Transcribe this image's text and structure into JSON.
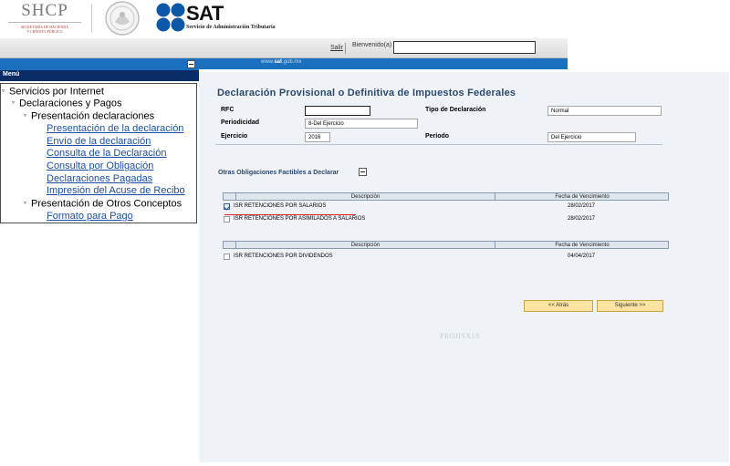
{
  "header": {
    "shcp_title": "SHCP",
    "shcp_subtitle_line1": "SECRETARÍA DE HACIENDA",
    "shcp_subtitle_line2": "Y CRÉDITO PÚBLICO",
    "sat_title": "SAT",
    "sat_subtitle": "Servicio de Administración Tributaria",
    "salir": "Salir",
    "bienvenido": "Bienvenido(a)",
    "bienvenido_value": "",
    "site_prefix": "www.",
    "site_bold": "sat",
    "site_suffix": ".gob.mx"
  },
  "menu": {
    "title": "Menú",
    "items": [
      {
        "label": "Servicios por Internet"
      },
      {
        "label": "Declaraciones y Pagos"
      },
      {
        "label": "Presentación declaraciones"
      },
      {
        "label": "Presentación de la declaración"
      },
      {
        "label": "Envío de la declaración"
      },
      {
        "label": "Consulta de la Declaración"
      },
      {
        "label": "Consulta por Obligación"
      },
      {
        "label": "Declaraciones Pagadas"
      },
      {
        "label": "Impresión del Acuse de Recibo"
      },
      {
        "label": "Presentación de Otros Conceptos"
      },
      {
        "label": "Formato para Pago"
      }
    ]
  },
  "form": {
    "title": "Declaración Provisional o Definitiva de Impuestos Federales",
    "rfc_label": "RFC",
    "rfc_value": "",
    "tipo_label": "Tipo de Declaración",
    "tipo_value": "Normal",
    "periodicidad_label": "Periodicidad",
    "periodicidad_value": "8-Del Ejercicio",
    "ejercicio_label": "Ejercicio",
    "ejercicio_value": "2016",
    "periodo_label": "Período",
    "periodo_value": "Del Ejercicio"
  },
  "obligaciones": {
    "title": "Otras Obligaciones Factibles a Declarar",
    "col_desc": "Descripción",
    "col_fecha": "Fecha de Vencimiento",
    "table1": [
      {
        "desc": "ISR RETENCIONES POR SALARIOS",
        "fecha": "28/02/2017",
        "checked": true
      },
      {
        "desc": "ISR RETENCIONES POR ASIMILADOS A SALARIOS",
        "fecha": "28/02/2017",
        "checked": false
      }
    ],
    "table2": [
      {
        "desc": "ISR RETENCIONES POR DIVIDENDOS",
        "fecha": "04/04/2017",
        "checked": false
      }
    ]
  },
  "buttons": {
    "atras": "<< Atrás",
    "siguiente": "Siguiente >>"
  },
  "footer_code": "PROIISX18",
  "colors": {
    "blue": "#1a6fbe",
    "navy": "#0a2c66",
    "title": "#2b4a6f",
    "button": "#fbe3a1"
  }
}
